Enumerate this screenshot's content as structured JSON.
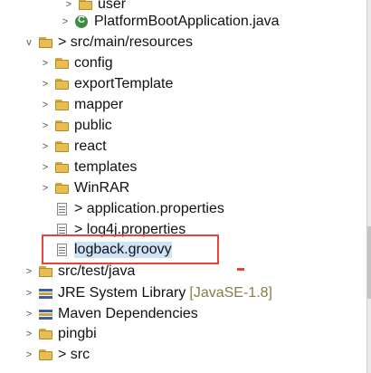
{
  "tree": {
    "rows": [
      {
        "label": "user",
        "icon": "package-icon",
        "toggle": ">"
      },
      {
        "label": "PlatformBootApplication.java",
        "icon": "java-class-icon",
        "toggle": ">"
      },
      {
        "label": "> src/main/resources",
        "icon": "source-folder-icon",
        "toggle": "v"
      },
      {
        "label": "config",
        "icon": "folder-icon",
        "toggle": ">"
      },
      {
        "label": "exportTemplate",
        "icon": "folder-icon",
        "toggle": ">"
      },
      {
        "label": "mapper",
        "icon": "folder-icon",
        "toggle": ">"
      },
      {
        "label": "public",
        "icon": "folder-icon",
        "toggle": ">"
      },
      {
        "label": "react",
        "icon": "folder-icon",
        "toggle": ">"
      },
      {
        "label": "templates",
        "icon": "folder-icon",
        "toggle": ">"
      },
      {
        "label": "WinRAR",
        "icon": "folder-icon",
        "toggle": ">"
      },
      {
        "label": "> application.properties",
        "icon": "file-icon",
        "toggle": ""
      },
      {
        "label": "> log4j.properties",
        "icon": "file-icon",
        "toggle": ""
      },
      {
        "label": "logback.groovy",
        "icon": "file-icon",
        "toggle": ""
      },
      {
        "label": "src/test/java",
        "icon": "source-folder-icon",
        "toggle": ">"
      },
      {
        "label": "JRE System Library",
        "sublabel": "[JavaSE-1.8]",
        "icon": "library-icon",
        "toggle": ">"
      },
      {
        "label": "Maven Dependencies",
        "icon": "library-icon",
        "toggle": ">"
      },
      {
        "label": "pingbi",
        "icon": "folder-icon",
        "toggle": ">"
      },
      {
        "label": "> src",
        "icon": "folder-icon",
        "toggle": ">"
      }
    ]
  },
  "colors": {
    "highlight": "#e8433a",
    "selection": "#cfe3f7"
  }
}
